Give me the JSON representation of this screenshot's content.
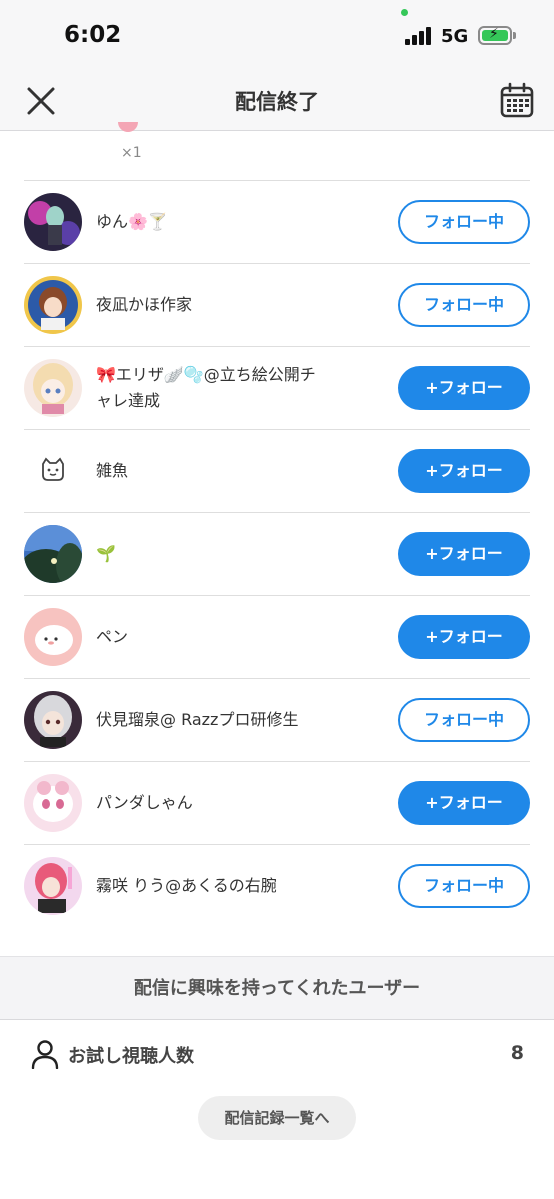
{
  "status_bar": {
    "time": "6:02",
    "network": "5G"
  },
  "header": {
    "title": "配信終了"
  },
  "top_partial": {
    "count": "×1"
  },
  "users": [
    {
      "name": "ゆん🌸🍸",
      "button": "フォロー中",
      "following": true
    },
    {
      "name": "夜凪かほ作家",
      "button": "フォロー中",
      "following": true
    },
    {
      "name": "🎀エリザ🪽🫧@立ち絵公開チャレ達成",
      "button": "+フォロー",
      "following": false
    },
    {
      "name": "雑魚",
      "button": "+フォロー",
      "following": false
    },
    {
      "name": "🌱",
      "button": "+フォロー",
      "following": false
    },
    {
      "name": "ペン",
      "button": "+フォロー",
      "following": false
    },
    {
      "name": "伏見瑠泉@ Razzプロ研修生",
      "button": "フォロー中",
      "following": true
    },
    {
      "name": "パンダしゃん",
      "button": "+フォロー",
      "following": false
    },
    {
      "name": "霧咲 りう@あくるの右腕",
      "button": "フォロー中",
      "following": true
    }
  ],
  "interest_section": {
    "title": "配信に興味を持ってくれたユーザー"
  },
  "trial_viewers": {
    "label": "お試し視聴人数",
    "value": "8"
  },
  "history_button": {
    "label": "配信記録一覧へ"
  },
  "colors": {
    "accent": "#1f88e8",
    "status_green": "#35c759"
  }
}
